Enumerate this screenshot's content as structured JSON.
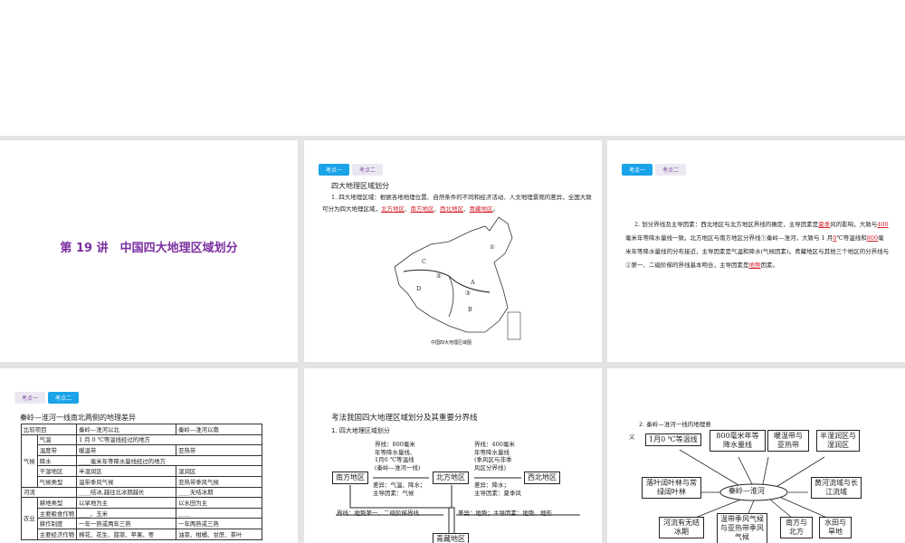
{
  "tabs": {
    "t1": "考点一",
    "t2": "考点二"
  },
  "slide1": {
    "title": "第 19 讲　中国四大地理区域划分"
  },
  "slide2": {
    "heading": "四大地理区域划分",
    "para1": "1. 四大地理区域：根据各地地理位置、自然条件的不同和经济活动、人文地理景观的差异，全国大致可分为四大地理区域，",
    "blank1": "北方地区",
    "blank2": "南方地区",
    "blank3": "西北地区",
    "blank4": "青藏地区",
    "map_labels": [
      "①",
      "②",
      "③",
      "A",
      "B",
      "C",
      "D"
    ],
    "map_caption": "中国四大地理区域图"
  },
  "slide3": {
    "p1": "2. 划分界线及主导因素：西北地区与北方地区界线的确定，主导因素是",
    "b1": "夏季",
    "p2": "风的影响，大致与",
    "b2": "400",
    "p3": "毫米年等降水量线一致。北方地区与南方地区分界线①秦岭—淮河，大致与 1 月",
    "b3": "0",
    "p4": "℃等温线和",
    "b4": "800",
    "p5": "毫米年等降水量线的分布接近，主导因素是气温和降水(气候因素)。青藏地区与其他三个地区的分界线与②第一、二级阶梯的界线基本吻合，主导因素是",
    "b5": "地势",
    "p6": "因素。"
  },
  "slide4": {
    "heading": "秦岭—淮河一线南北两侧的地理差异",
    "rows": [
      [
        "比较项目",
        "",
        "秦岭—淮河以北",
        "秦岭—淮河以南"
      ],
      [
        "气候",
        "气温",
        "1 月 0 ℃等温线经过的地方",
        ""
      ],
      [
        "",
        "温度带",
        "暖温带",
        "亚热带"
      ],
      [
        "",
        "降水",
        "____毫米年等降水量线经过的地方",
        ""
      ],
      [
        "",
        "干湿地区",
        "半湿润区",
        "湿润区"
      ],
      [
        "",
        "气候类型",
        "温带季风气候",
        "亚热带季风气候"
      ],
      [
        "河流",
        "",
        "____结冰,越往北冰期越长",
        "____无结冰期"
      ],
      [
        "农业",
        "耕地类型",
        "以旱地为主",
        "以水田为主"
      ],
      [
        "",
        "主要粮食作物",
        "____、玉米",
        "____"
      ],
      [
        "",
        "耕作制度",
        "一年一熟或两年三熟",
        "一年两熟或三熟"
      ],
      [
        "",
        "主要经济作物",
        "棉花、花生、甜菜、苹果、枣",
        "油菜、柑橘、甘蔗、茶叶"
      ]
    ]
  },
  "slide5": {
    "heading": "考法我国四大地理区域划分及其重要分界线",
    "sub": "1. 四大地理区域划分",
    "south": "南方地区",
    "north": "北方地区",
    "northwest": "西北地区",
    "tibet": "青藏地区",
    "line1": "界线：800毫米\n年等降水量线、\n1月0 ℃等温线\n(秦岭—淮河一线)",
    "diff1": "差异：气温、降水；\n主导因素：气候",
    "line2": "界线：400毫米\n年等降水量线\n(季风区与非季\n风区分界线)",
    "diff2": "差异：降水；\n主导因素：夏季风",
    "line3": "界线：地势第一、二级阶梯界线",
    "diff3": "差异：地势；主导因素：地势、地形"
  },
  "slide6": {
    "heading": "2. 秦岭—淮河一线的地理意",
    "heading2": "义",
    "center": "秦岭—淮河",
    "nodes": [
      "1月0 ℃等温线",
      "800毫米年等降水量线",
      "暖温带与亚热带",
      "半湿润区与湿润区",
      "落叶阔叶林与常绿阔叶林",
      "黄河流域与长江流域",
      "河流有无结冰期",
      "温带季风气候与亚热带季风气候",
      "南方与北方",
      "水田与旱地"
    ]
  }
}
